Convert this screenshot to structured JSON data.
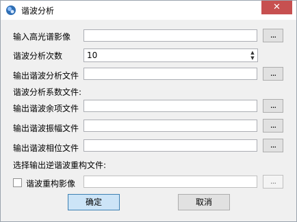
{
  "window": {
    "title": "谐波分析",
    "close_glyph": "✕"
  },
  "fields": {
    "input_hyperspectral_label": "输入高光谱影像",
    "harmonic_order_label": "谐波分析次数",
    "harmonic_order_value": "10",
    "output_analysis_label": "输出谐波分析文件",
    "coefficient_section_label": "谐波分析系数文件:",
    "output_cosine_label": "输出谐波余项文件",
    "output_amplitude_label": "输出谐波振幅文件",
    "output_phase_label": "输出谐波相位文件",
    "reconstruct_section_label": "选择输出逆谐波重构文件:",
    "reconstruct_image_label": "谐波重构影像",
    "browse_label": "..."
  },
  "buttons": {
    "ok": "确定",
    "cancel": "取消"
  }
}
